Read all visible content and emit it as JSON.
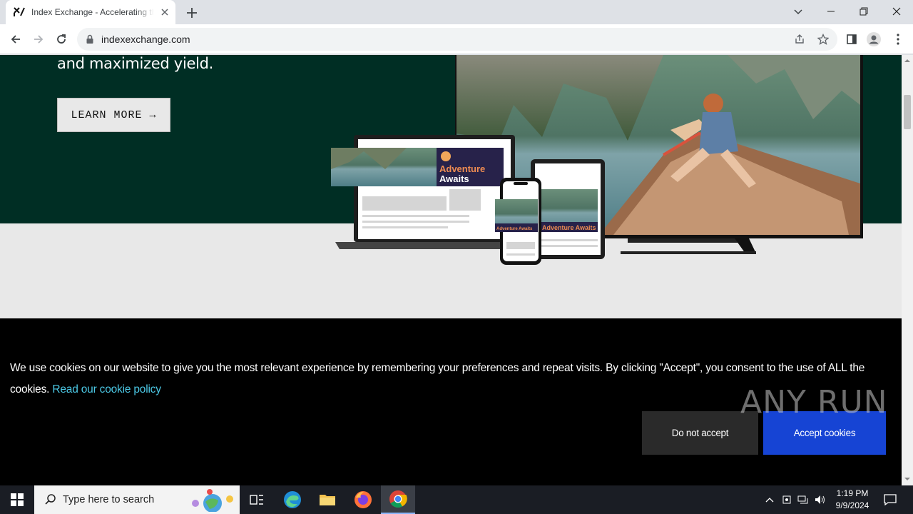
{
  "browser": {
    "tab_title": "Index Exchange - Accelerating the",
    "url": "indexexchange.com"
  },
  "page": {
    "hero_text": "and maximized yield.",
    "learn_more_label": "LEARN MORE →",
    "ad_headline_1": "Adventure",
    "ad_headline_2": "Awaits",
    "ad_small_tablet": "Adventure Awaits",
    "ad_small_phone": "Adventure Awaits"
  },
  "cookie_banner": {
    "text": "We use cookies on our website to give you the most relevant experience by remembering your preferences and repeat visits. By clicking \"Accept\", you consent to the use of ALL the cookies.",
    "link_text": "Read our cookie policy",
    "decline_label": "Do not accept",
    "accept_label": "Accept cookies"
  },
  "watermark": "ANY RUN",
  "taskbar": {
    "search_placeholder": "Type here to search",
    "time": "1:19 PM",
    "date": "9/9/2024"
  },
  "colors": {
    "hero_bg": "#002e24",
    "accept_bg": "#1644d4",
    "link": "#4cc9e6"
  }
}
